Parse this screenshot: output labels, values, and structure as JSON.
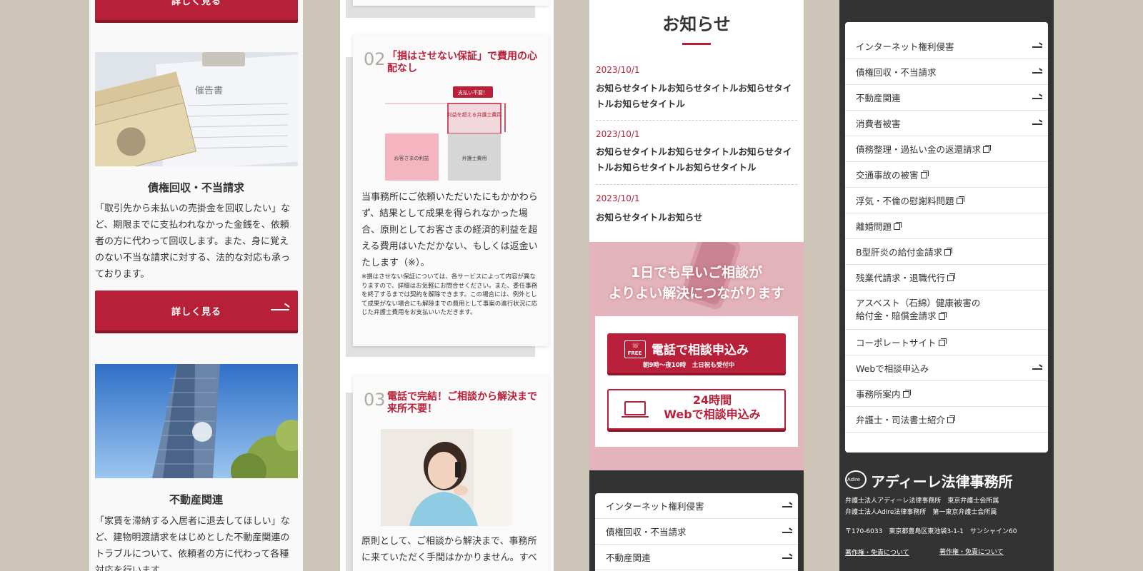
{
  "panel1": {
    "top_button": "詳しく見る",
    "card1": {
      "photo_label": "催告書",
      "title": "債権回収・不当請求",
      "text": "「取引先から未払いの売掛金を回収したい」など、期限までに支払われなかった金銭を、依頼者の方に代わって回収します。また、身に覚えのない不当な請求に対する、法的な対応も承っております。",
      "button": "詳しく見る"
    },
    "card2": {
      "title": "不動産関連",
      "text": "「家賃を滞納する入居者に退去してほしい」など、建物明渡請求をはじめとした不動産関連のトラブルについて、依頼者の方に代わって各種対応を行います。"
    }
  },
  "panel2": {
    "feature2": {
      "num": "02",
      "title": "「損はさせない保証」で費用の心配なし",
      "diagram": {
        "badge": "支払い不要！",
        "box_top": "利益を超える弁護士費用",
        "left_bar": "お客さまの利益",
        "right_bar": "弁護士費用"
      },
      "text": "当事務所にご依頼いただいたにもかかわらず、結果として成果を得られなかった場合、原則としてお客さまの経済的利益を超える費用はいただかない、もしくは返金いたします（※）。",
      "note": "※損はさせない保証については、各サービスによって内容が異なりますので、詳細はお気軽にお問合せください。また、委任事務を終了するまでは契約を解除できます。この場合には、例外として成果がない場合にも解除までの費用として事案の進行状況に応じた弁護士費用をお支払いいただきます。"
    },
    "feature3": {
      "num": "03",
      "title": "電話で完結！ご相談から解決まで来所不要！",
      "text": "原則として、ご相談から解決まで、事務所に来ていただく手間はかかりません。すべ"
    }
  },
  "panel3": {
    "heading": "お知らせ",
    "news": [
      {
        "date": "2023/10/1",
        "title": "お知らせタイトルお知らせタイトルお知らせタイトルお知らせタイトル"
      },
      {
        "date": "2023/10/1",
        "title": "お知らせタイトルお知らせタイトルお知らせタイトルお知らせタイトルお知らせタイトル"
      },
      {
        "date": "2023/10/1",
        "title": "お知らせタイトルお知らせ"
      }
    ],
    "cta": {
      "line1": "1日でも早いご相談が",
      "line2": "よりよい解決につながります",
      "tel_label": "電話で相談申込み",
      "tel_icon": "FREE",
      "tel_hours": "朝9時〜夜10時　土日祝も受付中",
      "web_line1": "24時間",
      "web_line2": "Webで相談申込み"
    },
    "nav": [
      "インターネット権利侵害",
      "債権回収・不当請求",
      "不動産関連"
    ]
  },
  "panel4": {
    "nav": [
      {
        "label": "インターネット権利侵害",
        "icon": "arrow"
      },
      {
        "label": "債権回収・不当請求",
        "icon": "arrow"
      },
      {
        "label": "不動産関連",
        "icon": "arrow"
      },
      {
        "label": "消費者被害",
        "icon": "arrow"
      },
      {
        "label": "債務整理・過払い金の返還請求",
        "icon": "external"
      },
      {
        "label": "交通事故の被害",
        "icon": "external"
      },
      {
        "label": "浮気・不倫の慰謝料問題",
        "icon": "external"
      },
      {
        "label": "離婚問題",
        "icon": "external"
      },
      {
        "label": "B型肝炎の給付金請求",
        "icon": "external"
      },
      {
        "label": "残業代請求・退職代行",
        "icon": "external"
      },
      {
        "label_1": "アスベスト（石綿）健康被害の",
        "label_2": "給付金・賠償金請求",
        "icon": "external"
      },
      {
        "label": "コーポレートサイト",
        "icon": "external"
      },
      {
        "label": "Webで相談申込み",
        "icon": "arrow"
      },
      {
        "label": "事務所案内",
        "icon": "external"
      },
      {
        "label": "弁護士・司法書士紹介",
        "icon": "external"
      }
    ],
    "footer": {
      "logo_mark": "Adire",
      "logo_text": "アディーレ法律事務所",
      "line1": "弁護士法人アディーレ法律事務所　東京弁護士会所属",
      "line2": "弁護士法人AdIre法律事務所　第一東京弁護士会所属",
      "address": "〒170-6033　東京都豊島区東池袋3-1-1　サンシャイン60",
      "link1": "著作権・免責について",
      "link2": "著作権・免責について"
    }
  },
  "colors": {
    "brand_red": "#b8203a",
    "pink": "#e4b4bc",
    "dark": "#333333",
    "bg": "#cdc5b8"
  }
}
